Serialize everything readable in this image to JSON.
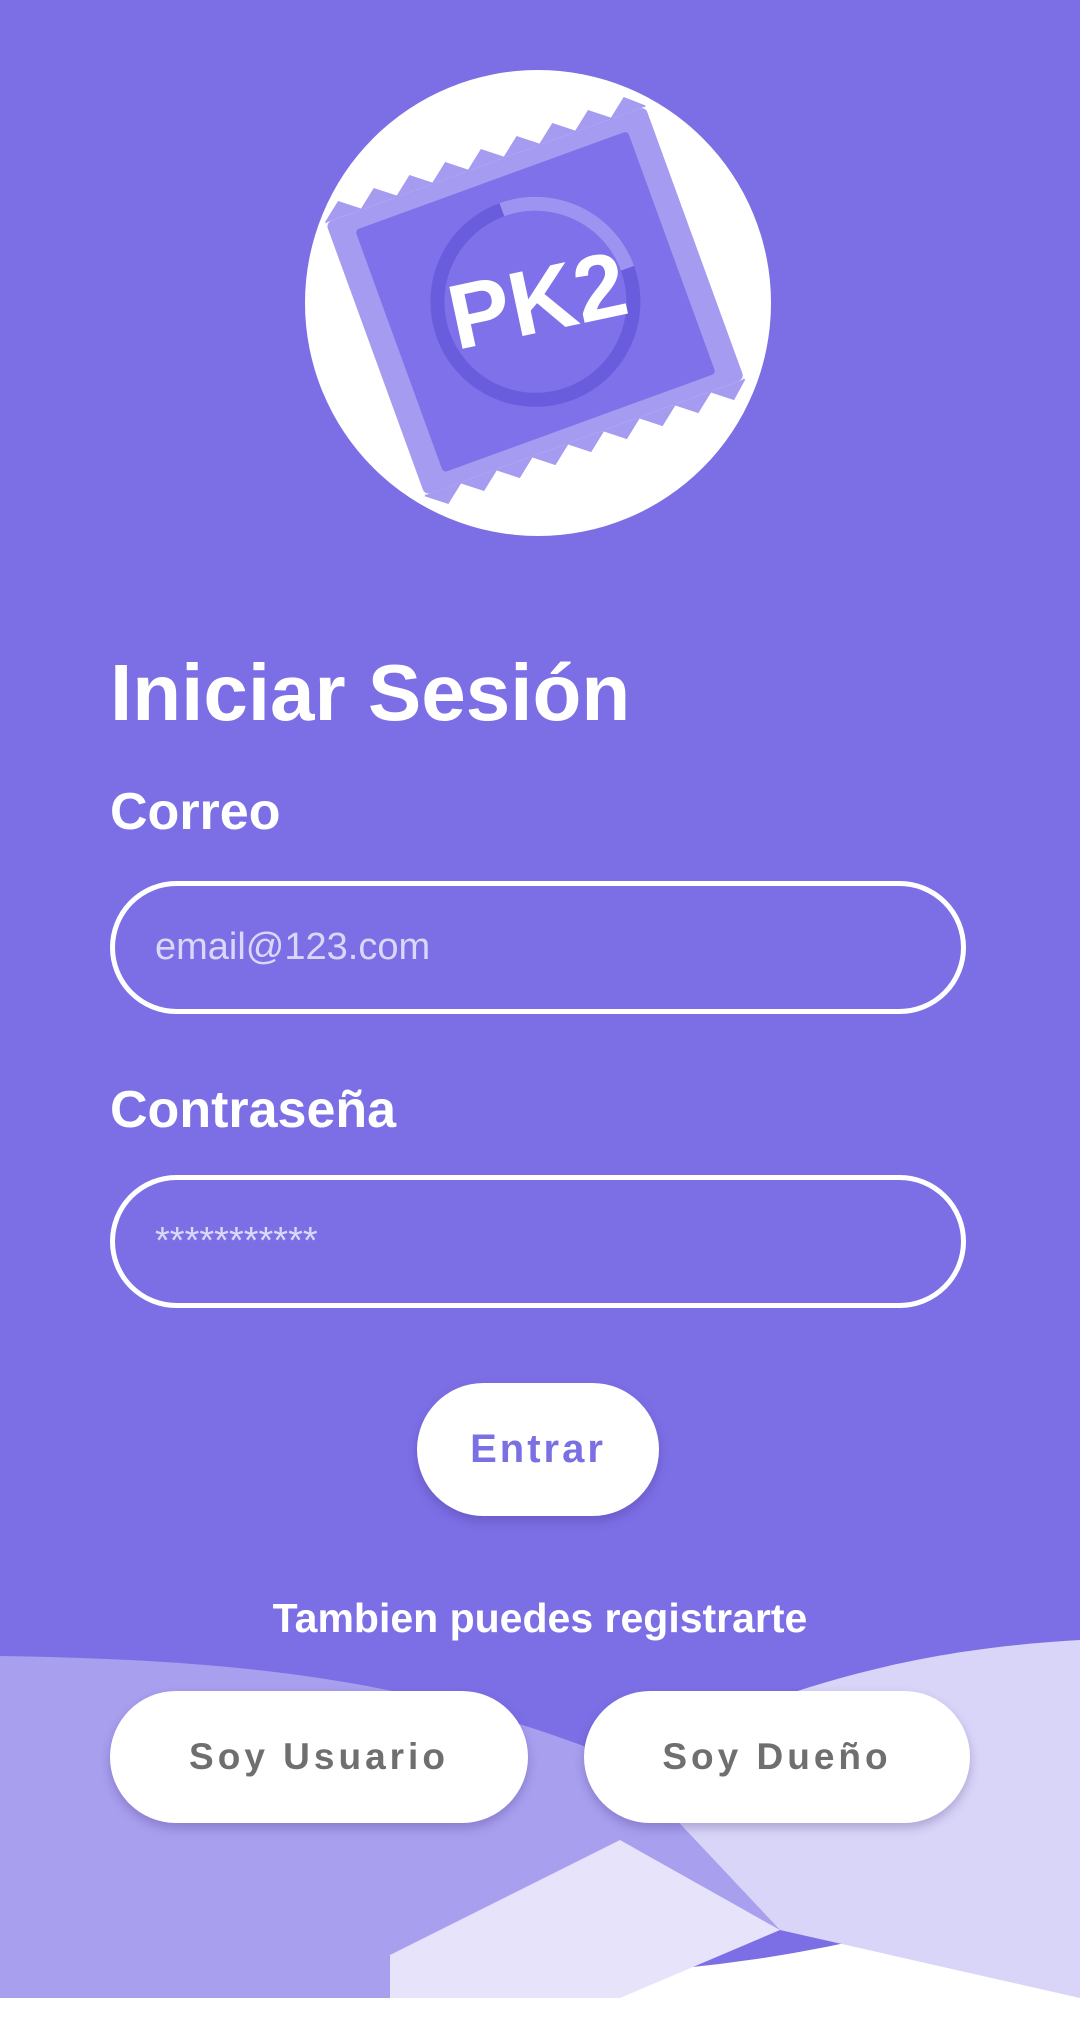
{
  "logo": {
    "text": "PK2",
    "icon": "pk2-condom-packet-logo"
  },
  "login": {
    "title": "Iniciar Sesión",
    "email_label": "Correo",
    "email_placeholder": "email@123.com",
    "password_label": "Contraseña",
    "password_placeholder": "***********",
    "submit_label": "Entrar"
  },
  "register": {
    "prompt": "Tambien puedes registrarte",
    "user_button": "Soy Usuario",
    "owner_button": "Soy Dueño"
  },
  "colors": {
    "primary": "#7b6fe4",
    "white": "#ffffff",
    "button_text_gray": "#6f6f6f",
    "wave_light": "#a89fef",
    "wave_lighter": "#d9d5f8"
  }
}
